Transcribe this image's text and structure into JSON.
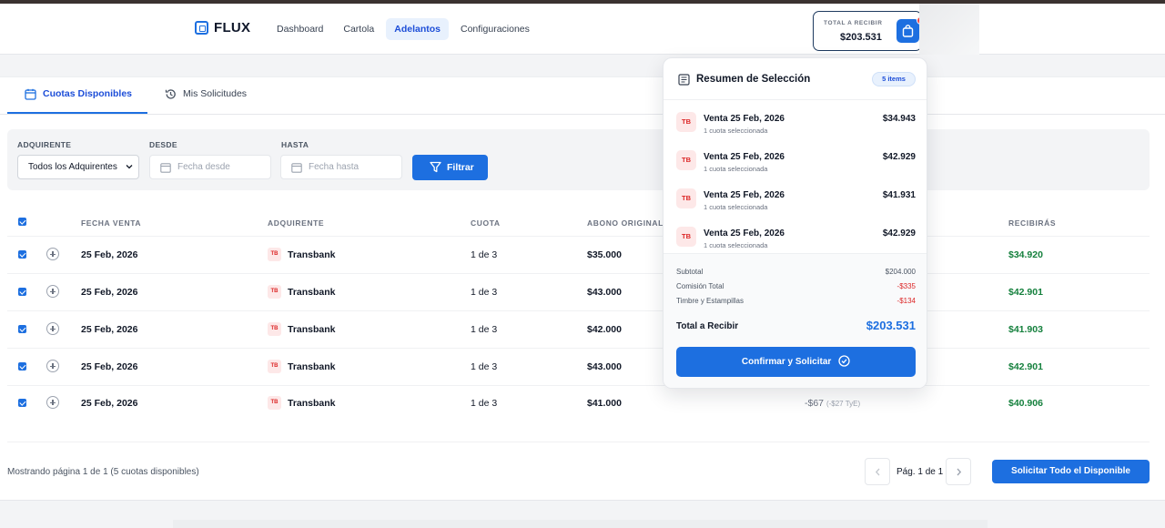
{
  "brand": {
    "name": "FLUX"
  },
  "nav": [
    "Dashboard",
    "Cartola",
    "Adelantos",
    "Configuraciones"
  ],
  "total_widget": {
    "label": "TOTAL A RECIBIR",
    "value": "$203.531"
  },
  "tabs": [
    "Cuotas Disponibles",
    "Mis Solicitudes"
  ],
  "filters": {
    "adquirente_label": "ADQUIRENTE",
    "adquirente_value": "Todos los Adquirentes",
    "desde_label": "DESDE",
    "desde_placeholder": "Fecha desde",
    "hasta_label": "HASTA",
    "hasta_placeholder": "Fecha hasta",
    "filter_button": "Filtrar"
  },
  "table": {
    "headers": [
      "FECHA VENTA",
      "ADQUIRENTE",
      "CUOTA",
      "ABONO ORIGINAL",
      "RECIBIRÁS"
    ],
    "rows": [
      {
        "fecha": "25 Feb, 2026",
        "badge": "TB",
        "adquirente": "Transbank",
        "cuota": "1 de 3",
        "abono": "$35.000",
        "recibiras": "$34.920"
      },
      {
        "fecha": "25 Feb, 2026",
        "badge": "TB",
        "adquirente": "Transbank",
        "cuota": "1 de 3",
        "abono": "$43.000",
        "recibiras": "$42.901"
      },
      {
        "fecha": "25 Feb, 2026",
        "badge": "TB",
        "adquirente": "Transbank",
        "cuota": "1 de 3",
        "abono": "$42.000",
        "recibiras": "$41.903"
      },
      {
        "fecha": "25 Feb, 2026",
        "badge": "TB",
        "adquirente": "Transbank",
        "cuota": "1 de 3",
        "abono": "$43.000",
        "recibiras": "$42.901"
      },
      {
        "fecha": "25 Feb, 2026",
        "badge": "TB",
        "adquirente": "Transbank",
        "cuota": "1 de 3",
        "abono": "$41.000",
        "recibiras": "$40.906",
        "comision": "-$67",
        "comision_note": "(-$27 TyE)"
      }
    ]
  },
  "footer": {
    "info": "Mostrando página 1 de 1 (5 cuotas disponibles)",
    "page": "Pág. 1 de 1",
    "request_all": "Solicitar Todo el Disponible"
  },
  "summary": {
    "title": "Resumen de Selección",
    "badge": "5 items",
    "items": [
      {
        "badge": "TB",
        "title": "Venta 25 Feb, 2026",
        "sub": "1 cuota seleccionada",
        "amount": "$34.943"
      },
      {
        "badge": "TB",
        "title": "Venta 25 Feb, 2026",
        "sub": "1 cuota seleccionada",
        "amount": "$42.929"
      },
      {
        "badge": "TB",
        "title": "Venta 25 Feb, 2026",
        "sub": "1 cuota seleccionada",
        "amount": "$41.931"
      },
      {
        "badge": "TB",
        "title": "Venta 25 Feb, 2026",
        "sub": "1 cuota seleccionada",
        "amount": "$42.929"
      }
    ],
    "subtotal_label": "Subtotal",
    "subtotal": "$204.000",
    "comision_label": "Comisión Total",
    "comision": "-$335",
    "timbre_label": "Timbre y Estampillas",
    "timbre": "-$134",
    "total_label": "Total a Recibir",
    "total": "$203.531",
    "confirm": "Confirmar y Solicitar"
  },
  "colors": {
    "primary": "#1d6fe0",
    "positive": "#15803d",
    "negative": "#dc2626"
  }
}
